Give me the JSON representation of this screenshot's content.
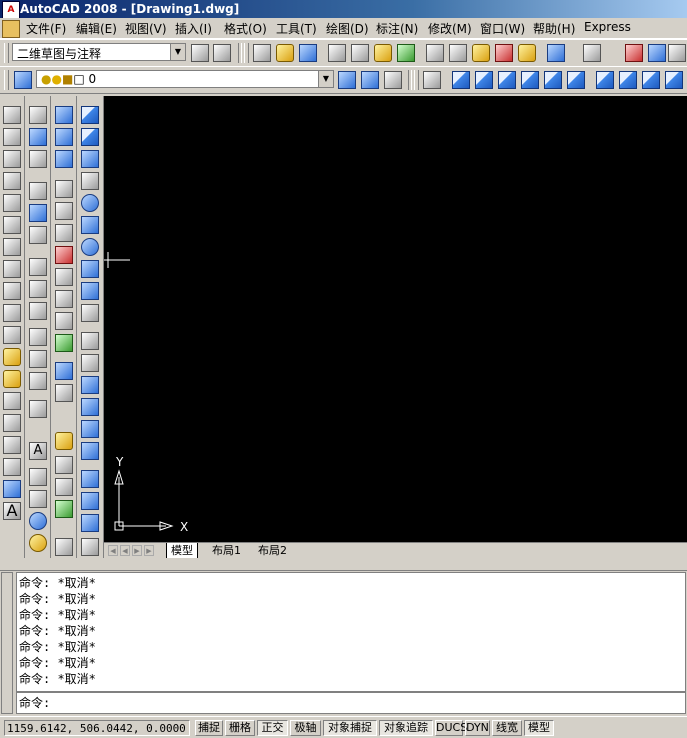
{
  "window": {
    "title": "AutoCAD 2008 - [Drawing1.dwg]",
    "app_icon_text": "A"
  },
  "menu": [
    "文件(F)",
    "编辑(E)",
    "视图(V)",
    "插入(I)",
    "格式(O)",
    "工具(T)",
    "绘图(D)",
    "标注(N)",
    "修改(M)",
    "窗口(W)",
    "帮助(H)",
    "Express"
  ],
  "workspace": {
    "value": "二维草图与注释"
  },
  "layer": {
    "value": "0"
  },
  "tabs": [
    "模型",
    "布局1",
    "布局2"
  ],
  "active_tab": "模型",
  "ucs": {
    "x_label": "X",
    "y_label": "Y"
  },
  "command_history": [
    "命令: *取消*",
    "命令: *取消*",
    "命令: *取消*",
    "命令: *取消*",
    "命令: *取消*",
    "命令: *取消*",
    "命令: *取消*"
  ],
  "command_prompt": "命令:",
  "coordinates": "1159.6142, 506.0442, 0.0000",
  "status_buttons": [
    {
      "label": "捕捉",
      "on": false
    },
    {
      "label": "栅格",
      "on": false
    },
    {
      "label": "正交",
      "on": true
    },
    {
      "label": "极轴",
      "on": false
    },
    {
      "label": "对象捕捉",
      "on": true
    },
    {
      "label": "对象追踪",
      "on": true
    },
    {
      "label": "DUCS",
      "on": false
    },
    {
      "label": "DYN",
      "on": false
    },
    {
      "label": "线宽",
      "on": false
    },
    {
      "label": "模型",
      "on": true
    }
  ],
  "colors": {
    "canvas": "#000000",
    "title_start": "#0a246a",
    "ucs": "#ffffff"
  }
}
